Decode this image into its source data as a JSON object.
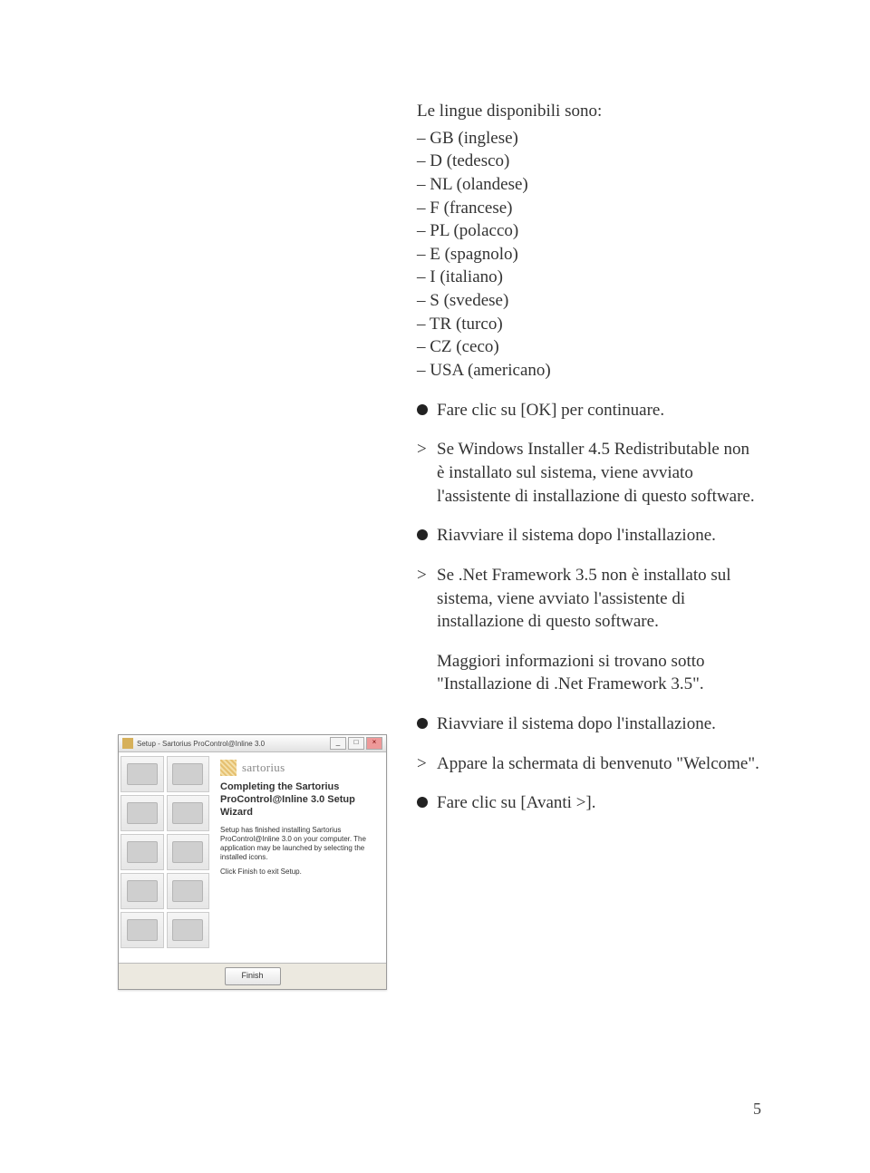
{
  "content": {
    "intro": "Le lingue disponibili sono:",
    "langs": [
      "GB (inglese)",
      "D (tedesco)",
      "NL (olandese)",
      "F (francese)",
      "PL (polacco)",
      "E (spagnolo)",
      "I (italiano)",
      "S (svedese)",
      "TR (turco)",
      "CZ (ceco)",
      "USA (americano)"
    ],
    "bullet1": "Fare clic su [OK] per continuare.",
    "gt1": "Se Windows Installer 4.5 Redistributable non è installato sul sistema, viene avviato l'assistente di installazione di questo software.",
    "bullet2": "Riavviare il sistema dopo l'installazione.",
    "gt2": "Se .Net Framework 3.5 non è installato sul sistema, viene avviato l'assistente di installazione di questo software.",
    "indent1": "Maggiori informazioni si trovano sotto \"Installazione di .Net Framework 3.5\".",
    "bullet3": "Riavviare il sistema dopo l'installazione.",
    "gt3": "Appare la schermata di benvenuto \"Welcome\".",
    "bullet4": "Fare clic su [Avanti >]."
  },
  "window": {
    "title": "Setup - Sartorius ProControl@Inline 3.0",
    "brand": "sartorius",
    "wiz_title": "Completing the Sartorius ProControl@Inline 3.0 Setup Wizard",
    "body1": "Setup has finished installing Sartorius ProControl@Inline 3.0 on your computer. The application may be launched by selecting the installed icons.",
    "body2": "Click Finish to exit Setup.",
    "finish": "Finish",
    "min": "_",
    "max": "□",
    "close": "×"
  },
  "page_num": "5"
}
